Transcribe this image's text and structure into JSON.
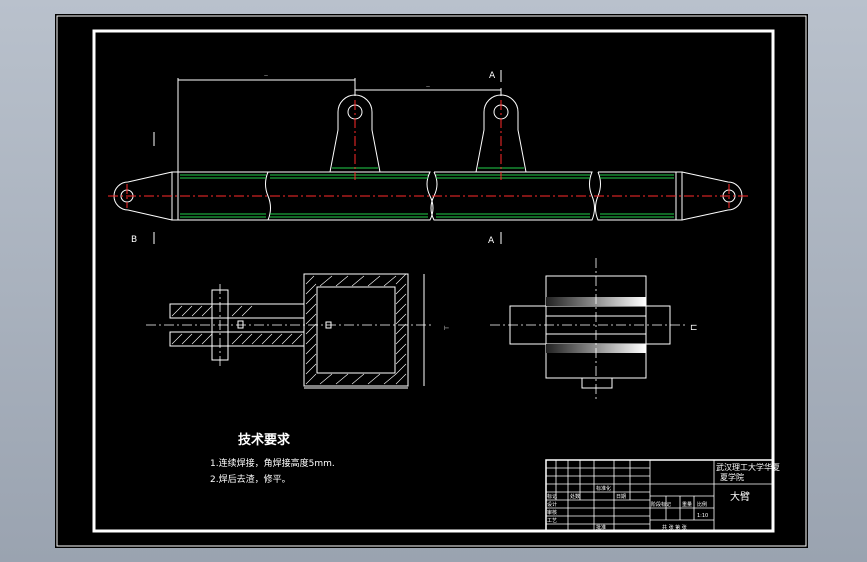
{
  "colors": {
    "background": "#a9b1bd",
    "canvas": "#000000",
    "line": "#ffffff",
    "centerline": "#ff2a2a",
    "weld": "#22d14a"
  },
  "view_labels": {
    "section_b": "B",
    "section_a": "A",
    "top_a": "A",
    "top_i": "I",
    "left_i": "I"
  },
  "tech": {
    "title": "技术要求",
    "line1": "1.连续焊接，角焊接高度5mm.",
    "line2": "2.焊后去渣，修平。"
  },
  "title_block": {
    "school_line1": "武汉理工大学华夏",
    "school_line2": "夏学院",
    "part_name": "大臂",
    "stage_mark": "阶段标记",
    "weight": "重量",
    "scale": "比例",
    "scale_value": "1:10",
    "sheet_total": "共 张 第 张",
    "designer": "设计",
    "checker": "审核",
    "craft": "工艺",
    "approve": "批准",
    "standard": "标准化",
    "marks": "标记",
    "count": "处数",
    "date": "日期"
  }
}
